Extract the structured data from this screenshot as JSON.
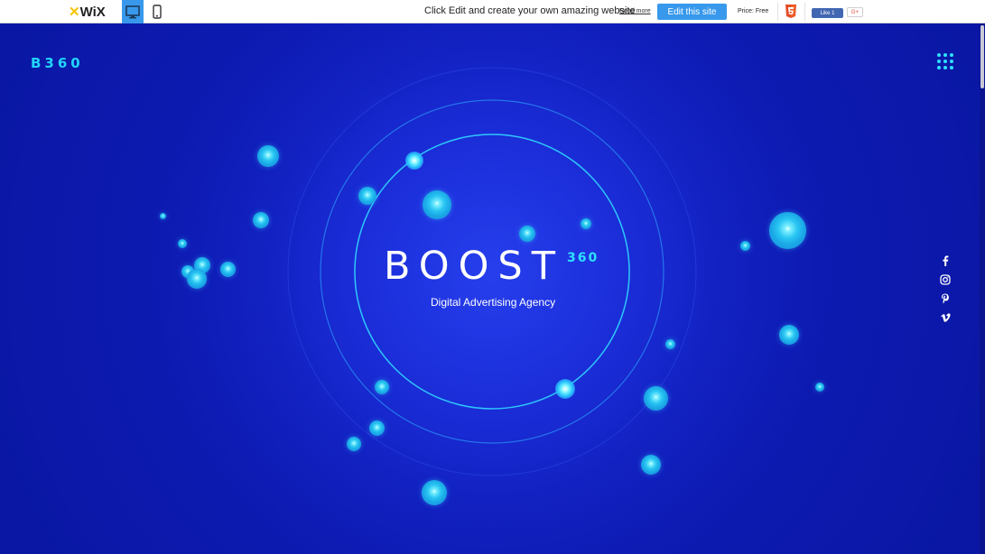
{
  "wixbar": {
    "logo_mark": "✕",
    "logo_text": "WiX",
    "promo_text": "Click Edit and create your own amazing website",
    "read_more": "Read more",
    "edit_button": "Edit this site",
    "price": "Price: Free",
    "fb_like": "Like 1",
    "gplus": "G+",
    "icons": [
      "desktop-icon",
      "mobile-icon",
      "html5-icon"
    ],
    "colors": {
      "accent": "#3899ec",
      "facebook": "#4267b2"
    }
  },
  "site": {
    "logo": "B360",
    "title": "BOOST",
    "title_sup": "360",
    "tagline": "Digital Advertising Agency",
    "menu_icon": "grid-menu-icon",
    "social": [
      "facebook-icon",
      "instagram-icon",
      "pinterest-icon",
      "vimeo-icon"
    ],
    "colors": {
      "background": "#0b1ba8",
      "accent": "#21d4fd"
    }
  }
}
